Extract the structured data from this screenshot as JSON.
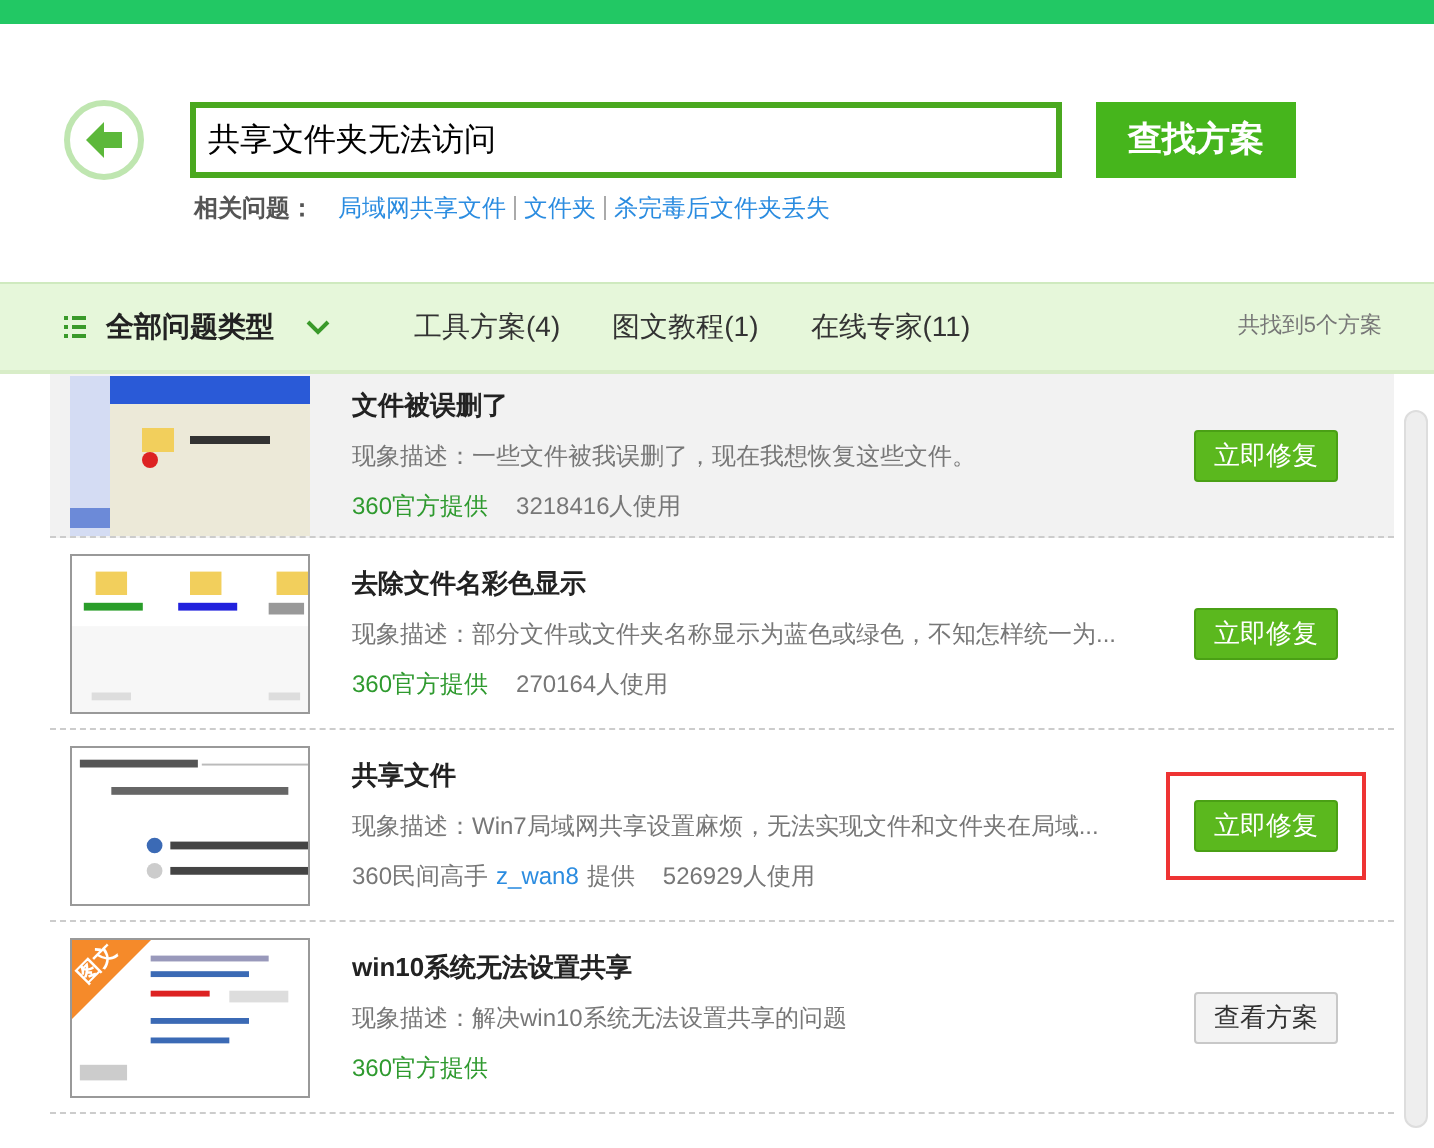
{
  "search": {
    "value": "共享文件夹无法访问",
    "button": "查找方案"
  },
  "related": {
    "label": "相关问题：",
    "links": [
      "局域网共享文件",
      "文件夹",
      "杀完毒后文件夹丢失"
    ]
  },
  "filter_bar": {
    "category": "全部问题类型",
    "tabs": [
      "工具方案(4)",
      "图文教程(1)",
      "在线专家(11)"
    ],
    "count": "共找到5个方案"
  },
  "results": [
    {
      "title": "文件被误删了",
      "description": "现象描述：一些文件被我误删了，现在我想恢复这些文件。",
      "provider": {
        "kind": "official",
        "text": "360官方提供"
      },
      "users": "3218416人使用",
      "button": {
        "kind": "fix",
        "label": "立即修复"
      },
      "hovered": true,
      "highlighted": false
    },
    {
      "title": "去除文件名彩色显示",
      "description": "现象描述：部分文件或文件夹名称显示为蓝色或绿色，不知怎样统一为...",
      "provider": {
        "kind": "official",
        "text": "360官方提供"
      },
      "users": "270164人使用",
      "button": {
        "kind": "fix",
        "label": "立即修复"
      },
      "hovered": false,
      "highlighted": false
    },
    {
      "title": "共享文件",
      "description": "现象描述：Win7局域网共享设置麻烦，无法实现文件和文件夹在局域...",
      "provider": {
        "kind": "user",
        "prefix": "360民间高手",
        "author": "z_wan8",
        "suffix": "提供"
      },
      "users": "526929人使用",
      "button": {
        "kind": "fix",
        "label": "立即修复"
      },
      "hovered": false,
      "highlighted": true
    },
    {
      "title": "win10系统无法设置共享",
      "badge": "图文",
      "description": "现象描述：解决win10系统无法设置共享的问题",
      "provider": {
        "kind": "official",
        "text": "360官方提供"
      },
      "button": {
        "kind": "view",
        "label": "查看方案"
      },
      "hovered": false,
      "highlighted": false
    }
  ]
}
